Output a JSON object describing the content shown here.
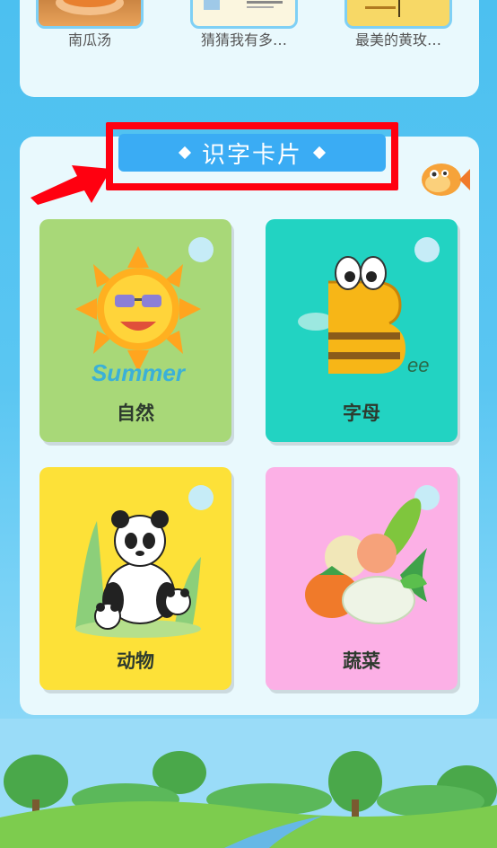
{
  "stories": [
    {
      "label": "南瓜汤"
    },
    {
      "label": "猜猜我有多…"
    },
    {
      "label": "最美的黄玫…"
    }
  ],
  "section": {
    "title": "识字卡片"
  },
  "cards": [
    {
      "label": "自然",
      "art_text": "Summer"
    },
    {
      "label": "字母",
      "art_text": "ee"
    },
    {
      "label": "动物"
    },
    {
      "label": "蔬菜"
    }
  ],
  "colors": {
    "card_nature": "#a8d878",
    "card_letters": "#22d3c2",
    "card_animals": "#fde138",
    "card_vegetables": "#fcb0e6",
    "title_button": "#3aacf4",
    "highlight": "#ff0010"
  }
}
